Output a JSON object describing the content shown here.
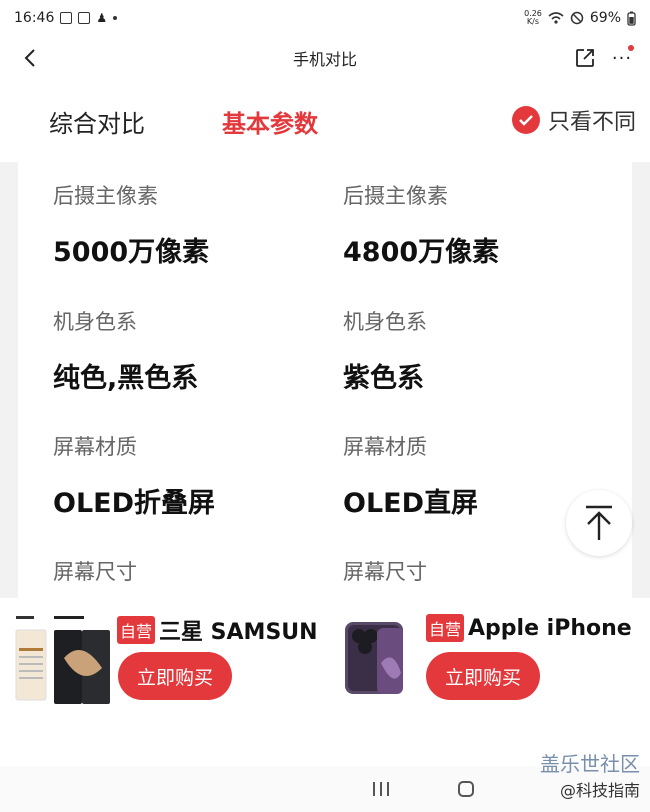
{
  "status": {
    "time": "16:46",
    "net_speed_top": "0.26",
    "net_speed_bottom": "K/s",
    "battery": "69%"
  },
  "nav": {
    "title": "手机对比"
  },
  "tabs": [
    {
      "label": "综合对比"
    },
    {
      "label": "基本参数"
    }
  ],
  "filter": {
    "only_diff_label": "只看不同"
  },
  "specs": [
    {
      "label": "后摄主像素",
      "left": "5000万像素",
      "right": "4800万像素"
    },
    {
      "label": "机身色系",
      "left": "纯色,黑色系",
      "right": "紫色系"
    },
    {
      "label": "屏幕材质",
      "left": "OLED折叠屏",
      "right": "OLED直屏"
    },
    {
      "label": "屏幕尺寸",
      "left": "",
      "right": ""
    }
  ],
  "products": [
    {
      "badge": "自营",
      "title": "三星 SAMSUN",
      "buy_label": "立即购买"
    },
    {
      "badge": "自营",
      "title": "Apple iPhone",
      "buy_label": "立即购买"
    }
  ],
  "watermark": {
    "line1": "盖乐世社区",
    "line2": "@科技指南"
  },
  "colors": {
    "accent": "#e4393c"
  }
}
